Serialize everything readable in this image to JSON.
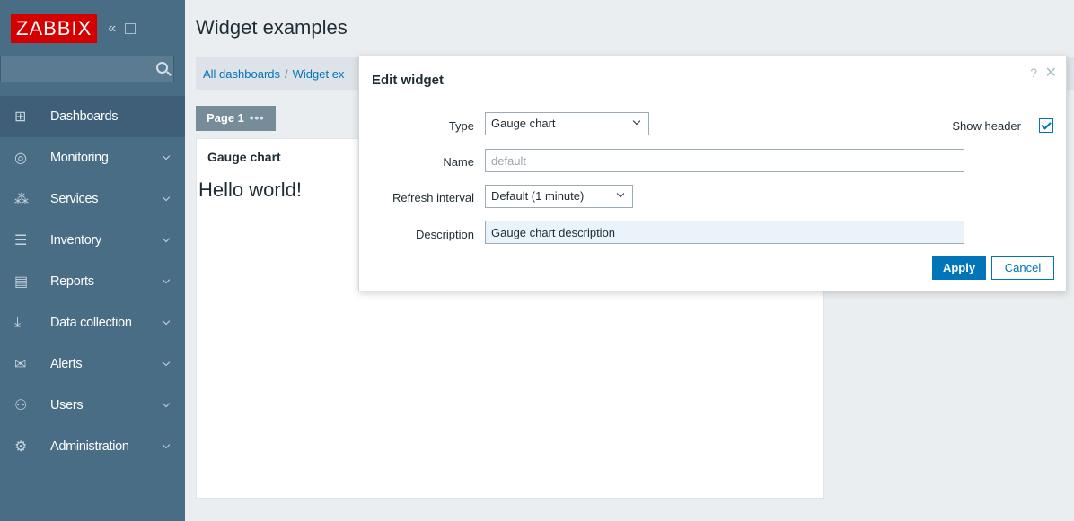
{
  "sidebar": {
    "logo": "ZABBIX",
    "collapse_glyph": "«",
    "kiosk_glyph": "⛶",
    "search_placeholder": "",
    "items": [
      {
        "label": "Dashboards",
        "icon": "dashboard-icon",
        "glyph": "⊞",
        "active": true
      },
      {
        "label": "Monitoring",
        "icon": "eye-icon",
        "glyph": "◎"
      },
      {
        "label": "Services",
        "icon": "services-icon",
        "glyph": "⁂"
      },
      {
        "label": "Inventory",
        "icon": "list-icon",
        "glyph": "☰"
      },
      {
        "label": "Reports",
        "icon": "report-icon",
        "glyph": "▤"
      },
      {
        "label": "Data collection",
        "icon": "download-icon",
        "glyph": "⤓"
      },
      {
        "label": "Alerts",
        "icon": "envelope-icon",
        "glyph": "✉"
      },
      {
        "label": "Users",
        "icon": "users-icon",
        "glyph": "⚇"
      },
      {
        "label": "Administration",
        "icon": "gear-icon",
        "glyph": "⚙"
      }
    ]
  },
  "header": {
    "title": "Widget examples",
    "breadcrumb": [
      "All dashboards",
      "Widget ex"
    ],
    "breadcrumb_sep": "/"
  },
  "page_tab": {
    "label": "Page 1",
    "dots": "•••"
  },
  "widget": {
    "title": "Gauge chart",
    "body": "Hello world!"
  },
  "dialog": {
    "title": "Edit widget",
    "help": "?",
    "close": "✕",
    "type_label": "Type",
    "type_value": "Gauge chart",
    "show_header_label": "Show header",
    "show_header_checked": true,
    "name_label": "Name",
    "name_placeholder": "default",
    "refresh_label": "Refresh interval",
    "refresh_value": "Default (1 minute)",
    "description_label": "Description",
    "description_value": "Gauge chart description",
    "apply": "Apply",
    "cancel": "Cancel"
  },
  "colors": {
    "sidebar": "#4a6d86",
    "logo_bg": "#d40000",
    "accent": "#0275b8"
  }
}
